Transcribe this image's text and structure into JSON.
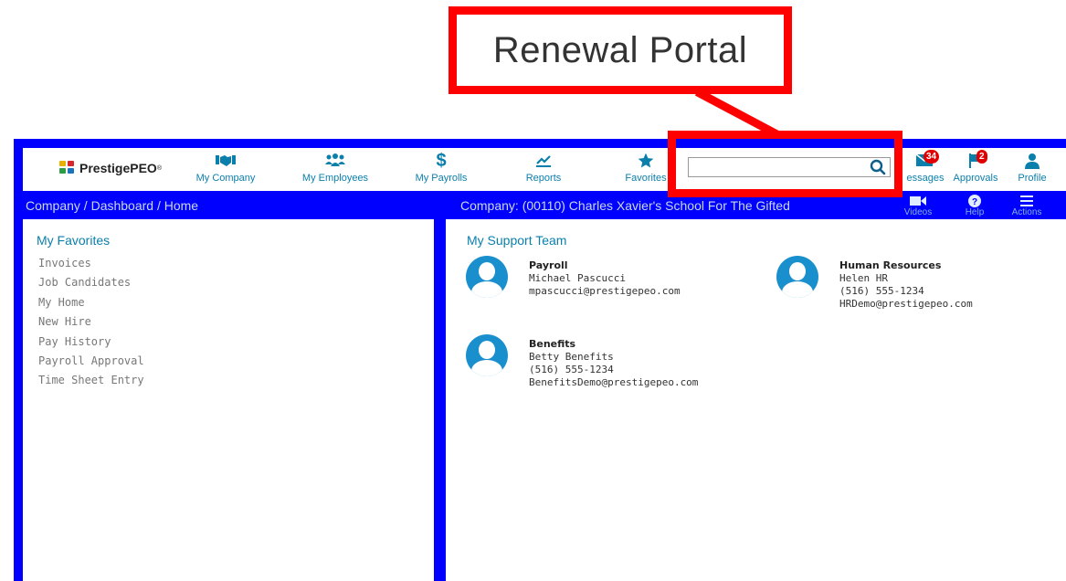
{
  "callout": {
    "text": "Renewal Portal"
  },
  "brand": {
    "name": "PrestigePEO",
    "tm": "®"
  },
  "nav": {
    "my_company": "My Company",
    "my_employees": "My Employees",
    "my_payrolls": "My Payrolls",
    "reports": "Reports",
    "favorites": "Favorites",
    "messages": "essages",
    "messages_count": "34",
    "approvals": "Approvals",
    "approvals_count": "2",
    "profile": "Profile"
  },
  "search": {
    "value": ""
  },
  "subbar": {
    "breadcrumb": "Company / Dashboard / Home",
    "company": "Company: (00110) Charles Xavier's School For The Gifted",
    "videos": "Videos",
    "help": "Help",
    "actions": "Actions"
  },
  "favorites": {
    "title": "My Favorites",
    "items": [
      "Invoices",
      "Job Candidates",
      "My Home",
      "New Hire",
      "Pay History",
      "Payroll Approval",
      "Time Sheet Entry"
    ]
  },
  "support": {
    "title": "My Support Team",
    "contacts": [
      {
        "role": "Payroll",
        "name": "Michael Pascucci",
        "phone": "",
        "email": "mpascucci@prestigepeo.com"
      },
      {
        "role": "Human Resources",
        "name": "Helen HR",
        "phone": "(516) 555-1234",
        "email": "HRDemo@prestigepeo.com"
      },
      {
        "role": "Benefits",
        "name": "Betty Benefits",
        "phone": "(516) 555-1234",
        "email": "BenefitsDemo@prestigepeo.com"
      }
    ]
  },
  "colors": {
    "frame": "#0000ff",
    "accent": "#0b7fab",
    "highlight": "#ff0000",
    "avatar": "#1a8fce"
  }
}
